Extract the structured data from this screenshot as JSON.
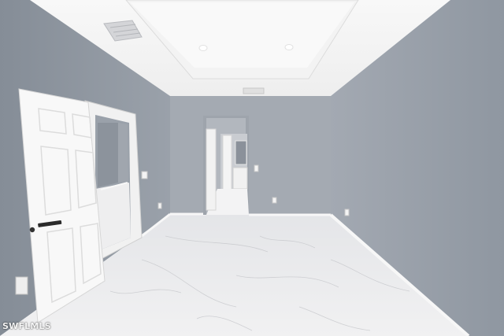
{
  "photo": {
    "watermark": "SWFLMLS"
  },
  "colors": {
    "wall_left": "#8e969f",
    "wall_right": "#99a0aa",
    "wall_back": "#a3a9b1",
    "ceiling": "#f5f5f5",
    "floor": "#eaeaec",
    "door": "#f8f8f8",
    "baseboard": "#f6f6f6"
  }
}
